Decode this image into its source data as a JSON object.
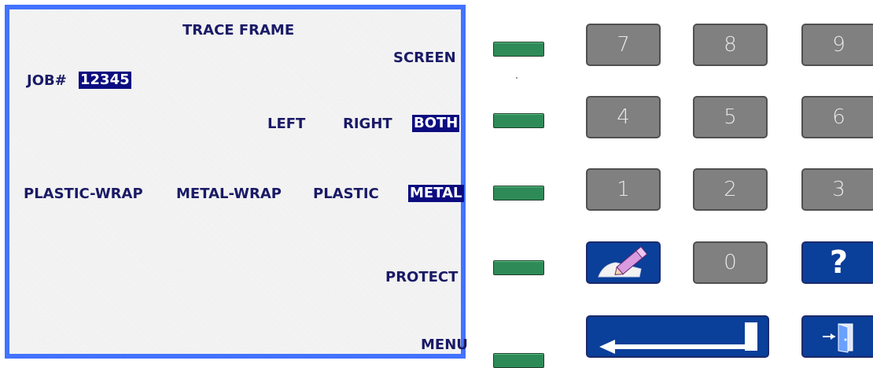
{
  "screen": {
    "title": "TRACE FRAME",
    "screen_label": "SCREEN",
    "job_label": "JOB#",
    "job_value": "12345 ",
    "side_options": [
      "LEFT",
      "RIGHT",
      "BOTH"
    ],
    "selected_side": "BOTH",
    "material_options": [
      "PLASTIC-WRAP",
      "METAL-WRAP",
      "PLASTIC",
      "METAL"
    ],
    "selected_material": "METAL",
    "protect_label": "PROTECT",
    "menu_label": "MENU"
  },
  "keypad": {
    "digits": [
      "7",
      "8",
      "9",
      "4",
      "5",
      "6",
      "1",
      "2",
      "3",
      "0"
    ],
    "help_label": "?"
  },
  "colors": {
    "screen_border": "#4272ff",
    "screen_text": "#1a1a66",
    "selection_bg": "#0c0c80",
    "softkey": "#2e8b58",
    "key_gray": "#808080",
    "key_blue": "#0a3f9a"
  },
  "icons": {
    "edit_key": "pencil-eraser-icon",
    "enter_key": "enter-arrow-icon",
    "exit_key": "exit-door-icon"
  }
}
